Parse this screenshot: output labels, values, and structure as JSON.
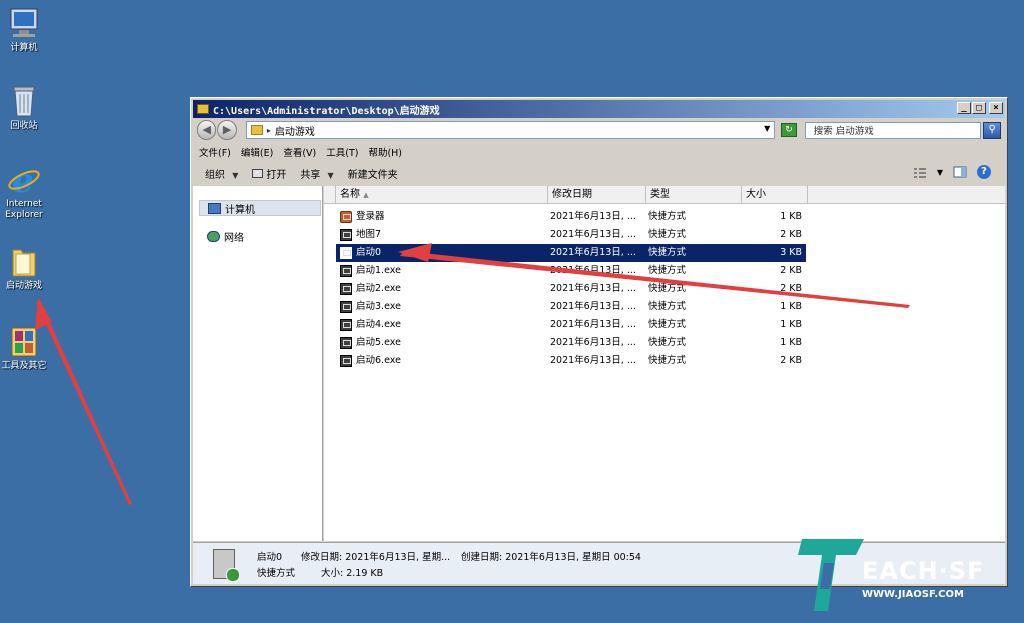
{
  "desktop": {
    "icons": [
      {
        "label": "计算机"
      },
      {
        "label": "回收站"
      },
      {
        "label": "Internet\nExplorer"
      },
      {
        "label": "启动游戏"
      },
      {
        "label": "工具及其它"
      }
    ]
  },
  "window": {
    "title": "C:\\Users\\Administrator\\Desktop\\启动游戏",
    "address": "启动游戏",
    "search_placeholder": "搜索 启动游戏",
    "menu": [
      "文件(F)",
      "编辑(E)",
      "查看(V)",
      "工具(T)",
      "帮助(H)"
    ],
    "toolbar": {
      "organize": "组织",
      "open": "打开",
      "share": "共享",
      "new_folder": "新建文件夹"
    },
    "nav": {
      "computer": "计算机",
      "network": "网络"
    },
    "columns": {
      "name": "名称",
      "date": "修改日期",
      "type": "类型",
      "size": "大小"
    },
    "files": [
      {
        "name": "登录器",
        "date": "2021年6月13日, ...",
        "type": "快捷方式",
        "size": "1 KB",
        "icon": "login-icon"
      },
      {
        "name": "地图7",
        "date": "2021年6月13日, ...",
        "type": "快捷方式",
        "size": "2 KB",
        "icon": "shortcut-icon"
      },
      {
        "name": "启动0",
        "date": "2021年6月13日, ...",
        "type": "快捷方式",
        "size": "3 KB",
        "icon": "shortcut-icon"
      },
      {
        "name": "启动1.exe",
        "date": "2021年6月13日, ...",
        "type": "快捷方式",
        "size": "2 KB",
        "icon": "shortcut-icon"
      },
      {
        "name": "启动2.exe",
        "date": "2021年6月13日, ...",
        "type": "快捷方式",
        "size": "2 KB",
        "icon": "shortcut-icon"
      },
      {
        "name": "启动3.exe",
        "date": "2021年6月13日, ...",
        "type": "快捷方式",
        "size": "1 KB",
        "icon": "shortcut-icon"
      },
      {
        "name": "启动4.exe",
        "date": "2021年6月13日, ...",
        "type": "快捷方式",
        "size": "1 KB",
        "icon": "shortcut-icon"
      },
      {
        "name": "启动5.exe",
        "date": "2021年6月13日, ...",
        "type": "快捷方式",
        "size": "1 KB",
        "icon": "shortcut-icon"
      },
      {
        "name": "启动6.exe",
        "date": "2021年6月13日, ...",
        "type": "快捷方式",
        "size": "2 KB",
        "icon": "shortcut-icon"
      }
    ],
    "status": {
      "name": "启动0",
      "modified": "修改日期: 2021年6月13日, 星期...",
      "created": "创建日期: 2021年6月13日, 星期日 00:54",
      "type": "快捷方式",
      "size": "大小: 2.19 KB"
    }
  },
  "watermark": {
    "brand": "EACH·SF",
    "url": "WWW.JIAOSF.COM"
  },
  "colors": {
    "desktop": "#3a6ea5",
    "selection": "#0a246a",
    "arrow": "#e03030",
    "logo": "#1fa89a"
  }
}
